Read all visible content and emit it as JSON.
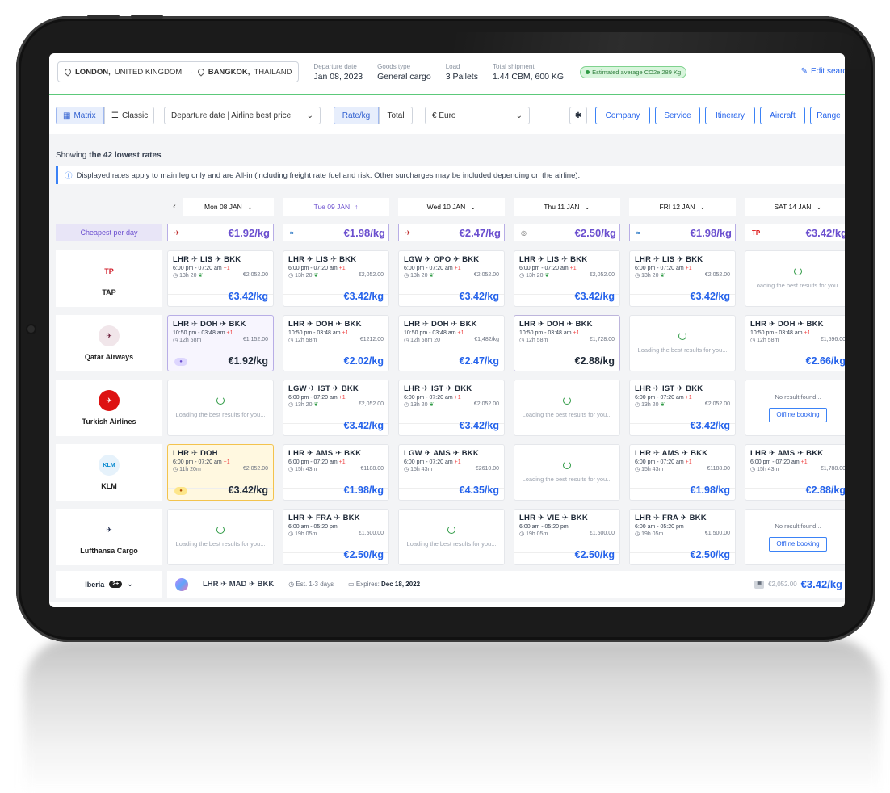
{
  "header": {
    "origin": "LONDON,",
    "origin_country": "UNITED KINGDOM",
    "destination": "BANGKOK,",
    "destination_country": "THAILAND",
    "departure_label": "Departure date",
    "departure_value": "Jan 08, 2023",
    "goods_label": "Goods type",
    "goods_value": "General cargo",
    "load_label": "Load",
    "load_value": "3 Pallets",
    "shipment_label": "Total shipment",
    "shipment_value": "1.44 CBM, 600 KG",
    "co2": "Estimated average CO2e 289 Kg",
    "edit": "Edit search"
  },
  "toolbar": {
    "matrix": "Matrix",
    "classic": "Classic",
    "sort": "Departure date | Airline best price",
    "rate": "Rate/kg",
    "total": "Total",
    "currency": "€ Euro",
    "filters": [
      "Company",
      "Service",
      "Itinerary",
      "Aircraft",
      "Range"
    ]
  },
  "showing_prefix": "Showing",
  "showing_bold": "the 42 lowest rates",
  "notice": "Displayed rates apply to main leg only and are All-in (including freight rate fuel and risk. Other surcharges may be included depending on the airline).",
  "days": [
    "Mon 08 JAN",
    "Tue 09 JAN",
    "Wed 10 JAN",
    "Thu 11 JAN",
    "FRI 12 JAN",
    "SAT 14 JAN"
  ],
  "cheapest_label": "Cheapest per day",
  "cheapest": [
    "€1.92/kg",
    "€1.98/kg",
    "€2.47/kg",
    "€2.50/kg",
    "€1.98/kg",
    "€3.42/kg"
  ],
  "loading_text": "Loading the best results for you...",
  "no_result_text": "No result found...",
  "offline_text": "Offline booking",
  "airlines": [
    "TAP",
    "Qatar Airways",
    "Turkish Airlines",
    "KLM",
    "Lufthansa Cargo"
  ],
  "rows": [
    [
      {
        "route": "LHR ✈ LIS ✈ BKK",
        "time": "6:00 pm - 07:20 am",
        "plus": "+1",
        "dur": "13h 20",
        "old": "€2,052.00",
        "price": "€3.42/kg"
      },
      {
        "route": "LHR ✈ LIS ✈ BKK",
        "time": "6:00 pm - 07:20 am",
        "plus": "+1",
        "dur": "13h 20",
        "old": "€2,052.00",
        "price": "€3.42/kg"
      },
      {
        "route": "LGW ✈ OPO ✈ BKK",
        "time": "6:00 pm - 07:20 am",
        "plus": "+1",
        "dur": "13h 20",
        "old": "€2,052.00",
        "price": "€3.42/kg"
      },
      {
        "route": "LHR ✈ LIS ✈ BKK",
        "time": "6:00 pm - 07:20 am",
        "plus": "+1",
        "dur": "13h 20",
        "old": "€2,052.00",
        "price": "€3.42/kg"
      },
      {
        "route": "LHR ✈ LIS ✈ BKK",
        "time": "6:00 pm - 07:20 am",
        "plus": "+1",
        "dur": "13h 20",
        "old": "€2,052.00",
        "price": "€3.42/kg"
      },
      {
        "loading": true
      }
    ],
    [
      {
        "route": "LHR ✈ DOH ✈ BKK",
        "time": "10:50 pm - 03:48 am",
        "plus": "+1",
        "dur": "12h 58m",
        "old": "€1,152.00",
        "price": "€1.92/kg"
      },
      {
        "route": "LHR ✈ DOH ✈ BKK",
        "time": "10:50 pm - 03:48 am",
        "plus": "+1",
        "dur": "12h 58m",
        "old": "€1212.00",
        "price": "€2.02/kg"
      },
      {
        "route": "LHR ✈ DOH ✈ BKK",
        "time": "10:50 pm - 03:48 am",
        "plus": "+1",
        "dur": "12h 58m 20",
        "old": "€1,482/kg",
        "price": "€2.47/kg"
      },
      {
        "route": "LHR ✈ DOH ✈ BKK",
        "time": "10:50 pm - 03:48 am",
        "plus": "+1",
        "dur": "12h 58m",
        "old": "€1,728.00",
        "price": "€2.88/kg"
      },
      {
        "loading": true
      },
      {
        "route": "LHR ✈ DOH ✈ BKK",
        "time": "10:50 pm - 03:48 am",
        "plus": "+1",
        "dur": "12h 58m",
        "old": "€1,596.00",
        "price": "€2.66/kg"
      }
    ],
    [
      {
        "loading": true
      },
      {
        "route": "LGW ✈ IST ✈ BKK",
        "time": "6:00 pm - 07:20 am",
        "plus": "+1",
        "dur": "13h 20",
        "old": "€2,052.00",
        "price": "€3.42/kg"
      },
      {
        "route": "LHR ✈ IST ✈ BKK",
        "time": "6:00 pm - 07:20 am",
        "plus": "+1",
        "dur": "13h 20",
        "old": "€2,052.00",
        "price": "€3.42/kg"
      },
      {
        "loading": true
      },
      {
        "route": "LHR ✈ IST ✈ BKK",
        "time": "6:00 pm - 07:20 am",
        "plus": "+1",
        "dur": "13h 20",
        "old": "€2,052.00",
        "price": "€3.42/kg"
      },
      {
        "noresult": true
      }
    ],
    [
      {
        "route": "LHR ✈ DOH",
        "time": "6:00 pm - 07:20 am",
        "plus": "+1",
        "dur": "11h 20m",
        "old": "€2,052.00",
        "price": "€3.42/kg"
      },
      {
        "route": "LHR ✈ AMS ✈ BKK",
        "time": "6:00 pm - 07:20 am",
        "plus": "+1",
        "dur": "15h 43m",
        "old": "€1188.00",
        "price": "€1.98/kg"
      },
      {
        "route": "LGW ✈ AMS ✈ BKK",
        "time": "6:00 pm - 07:20 am",
        "plus": "+1",
        "dur": "15h 43m",
        "old": "€2610.00",
        "price": "€4.35/kg"
      },
      {
        "loading": true
      },
      {
        "route": "LHR ✈ AMS ✈ BKK",
        "time": "6:00 pm - 07:20 am",
        "plus": "+1",
        "dur": "15h 43m",
        "old": "€1188.00",
        "price": "€1.98/kg"
      },
      {
        "route": "LHR ✈ AMS ✈ BKK",
        "time": "6:00 pm - 07:20 am",
        "plus": "+1",
        "dur": "15h 43m",
        "old": "€1,788.00",
        "price": "€2.88/kg"
      }
    ],
    [
      {
        "loading": true
      },
      {
        "route": "LHR ✈ FRA ✈ BKK",
        "time": "6:00 am - 05:20 pm",
        "plus": "",
        "dur": "19h 05m",
        "old": "€1,500.00",
        "price": "€2.50/kg"
      },
      {
        "loading": true
      },
      {
        "route": "LHR ✈ VIE ✈ BKK",
        "time": "6:00 am - 05:20 pm",
        "plus": "",
        "dur": "19h 05m",
        "old": "€1,500.00",
        "price": "€2.50/kg"
      },
      {
        "route": "LHR ✈ FRA ✈ BKK",
        "time": "6:00 am - 05:20 pm",
        "plus": "",
        "dur": "19h 05m",
        "old": "€1,500.00",
        "price": "€2.50/kg"
      },
      {
        "noresult": true
      }
    ]
  ],
  "iberia": {
    "name": "Iberia",
    "count": "2+",
    "route": "LHR ✈ MAD ✈ BKK",
    "est": "Est. 1-3 days",
    "expires_label": "Expires:",
    "expires": "Dec 18, 2022",
    "old": "€2,052.00",
    "price": "€3.42/kg"
  },
  "colors": {
    "accent": "#2563eb",
    "purple": "#6b4fcf",
    "green": "#5cc97a"
  }
}
